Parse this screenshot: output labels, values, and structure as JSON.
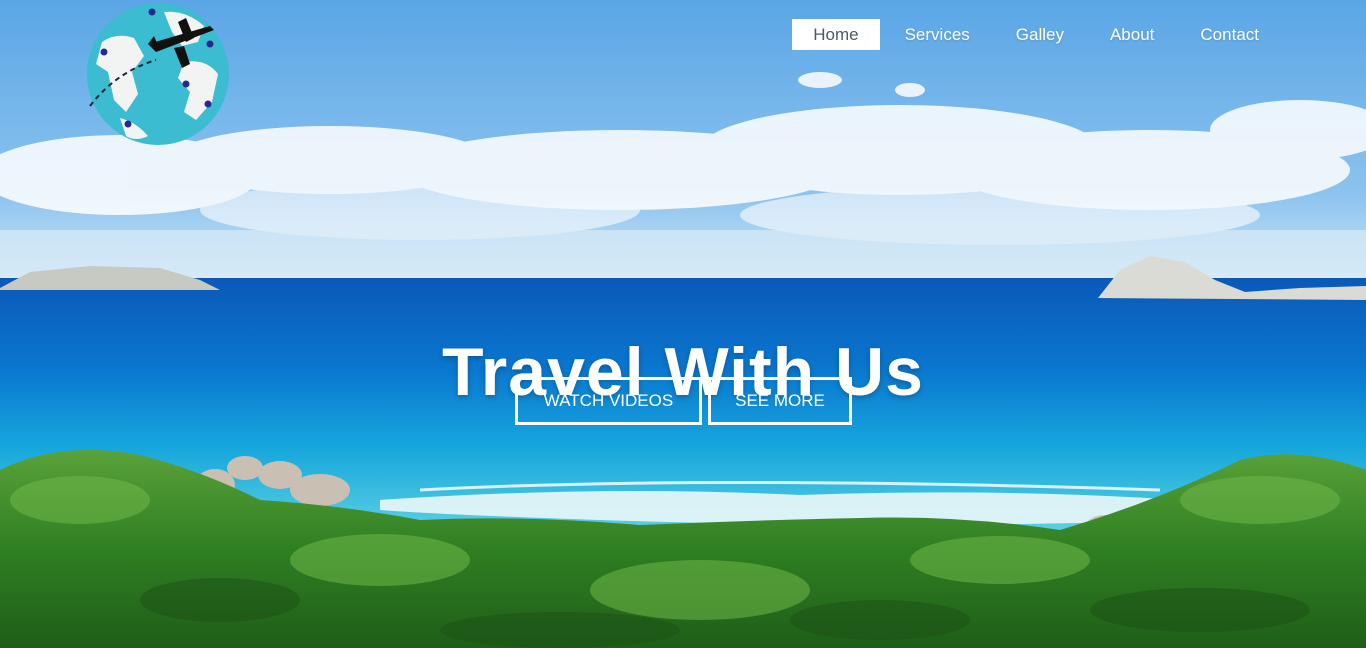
{
  "nav": {
    "items": [
      {
        "label": "Home",
        "active": true
      },
      {
        "label": "Services",
        "active": false
      },
      {
        "label": "Galley",
        "active": false
      },
      {
        "label": "About",
        "active": false
      },
      {
        "label": "Contact",
        "active": false
      }
    ]
  },
  "logo": {
    "icon": "globe-airplane-icon"
  },
  "hero": {
    "title": "Travel With Us",
    "buttons": {
      "watch_videos": "WATCH VIDEOS",
      "see_more": "SEE MORE"
    }
  },
  "colors": {
    "sky": "#5aa6e6",
    "sea": "#0a68c8",
    "lagoon": "#1fb6d9",
    "vegetation": "#3c8a2a",
    "accent": "#ffffff"
  }
}
